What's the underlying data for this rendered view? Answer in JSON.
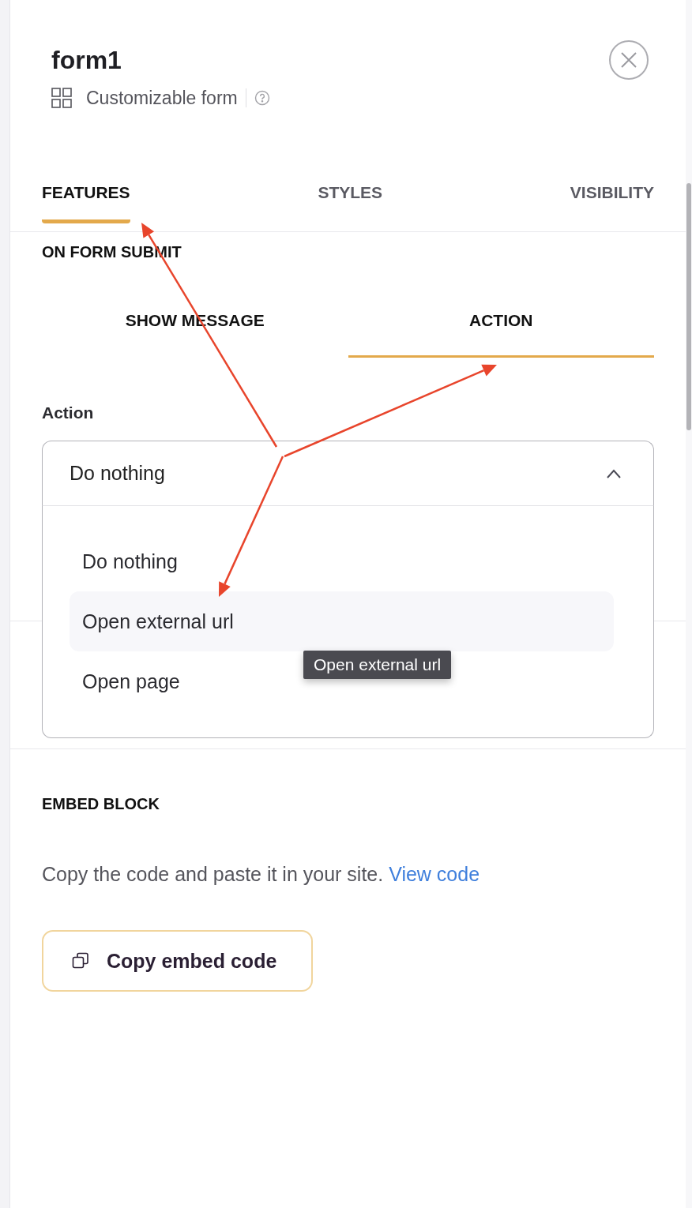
{
  "panel": {
    "title": "form1",
    "subtitle": "Customizable form"
  },
  "tabs": [
    {
      "label": "FEATURES",
      "selected": true
    },
    {
      "label": "STYLES",
      "selected": false
    },
    {
      "label": "VISIBILITY",
      "selected": false
    }
  ],
  "submit_section": {
    "title": "ON FORM SUBMIT",
    "tabs": [
      {
        "label": "SHOW MESSAGE",
        "selected": false
      },
      {
        "label": "ACTION",
        "selected": true
      }
    ],
    "action_field": {
      "label": "Action",
      "value": "Do nothing",
      "expanded": true,
      "options": [
        {
          "label": "Do nothing",
          "hovered": false
        },
        {
          "label": "Open external url",
          "hovered": true
        },
        {
          "label": "Open page",
          "hovered": false
        }
      ],
      "tooltip": "Open external url"
    }
  },
  "embed": {
    "title": "EMBED BLOCK",
    "text": "Copy the code and paste it in your site.",
    "link": "View code",
    "button": "Copy embed code"
  }
}
